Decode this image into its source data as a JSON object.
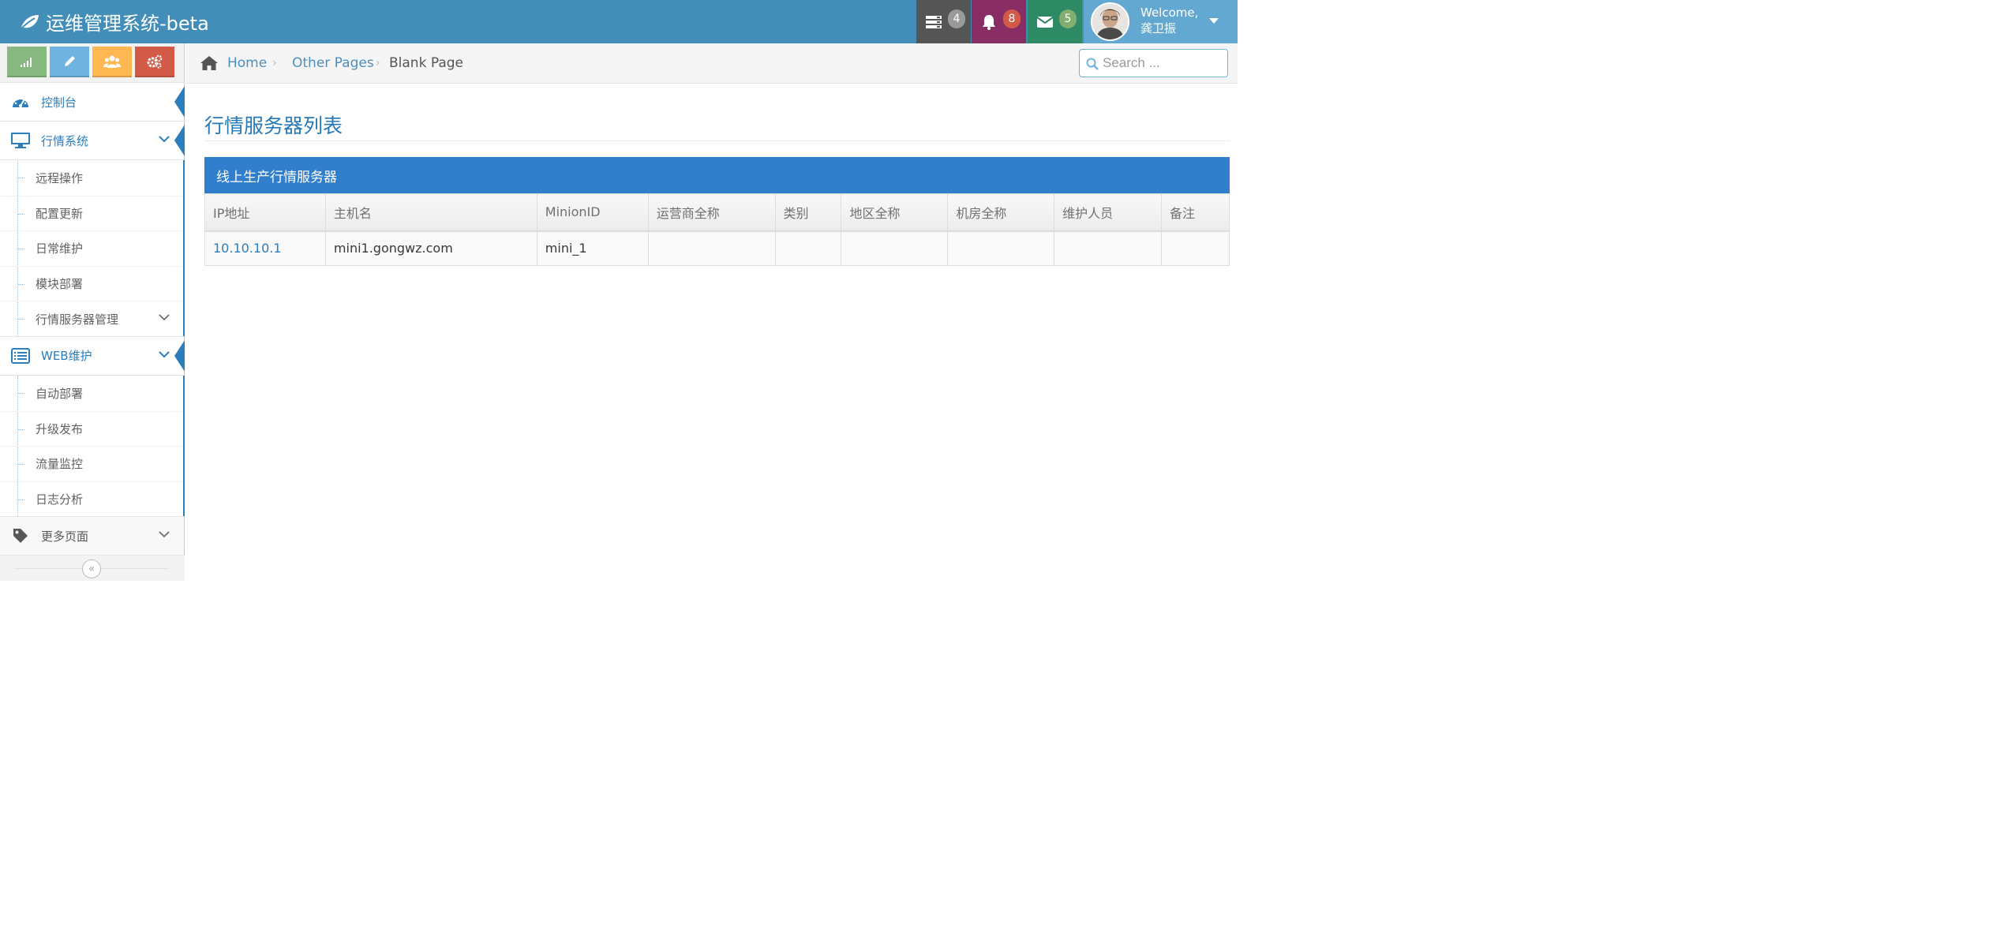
{
  "navbar": {
    "brand": "运维管理系统-beta",
    "tasks_count": "4",
    "notifications_count": "8",
    "messages_count": "5",
    "welcome": "Welcome,",
    "username": "龚卫振"
  },
  "sidebar": {
    "shortcuts": [
      "signal-icon",
      "pencil-icon",
      "group-icon",
      "cogs-icon"
    ],
    "dashboard": "控制台",
    "market_system": {
      "label": "行情系统",
      "items": [
        "远程操作",
        "配置更新",
        "日常维护",
        "模块部署",
        "行情服务器管理"
      ]
    },
    "web_maint": {
      "label": "WEB维护",
      "items": [
        "自动部署",
        "升级发布",
        "流量监控",
        "日志分析"
      ]
    },
    "more_pages": "更多页面"
  },
  "breadcrumbs": {
    "home": "Home",
    "other": "Other Pages",
    "current": "Blank Page"
  },
  "search": {
    "placeholder": "Search ..."
  },
  "page_title": "行情服务器列表",
  "panel_title": "线上生产行情服务器",
  "table": {
    "headers": [
      "IP地址",
      "主机名",
      "MinionID",
      "运营商全称",
      "类别",
      "地区全称",
      "机房全称",
      "维护人员",
      "备注"
    ],
    "rows": [
      [
        "10.10.10.1",
        "mini1.gongwz.com",
        "mini_1",
        "",
        "",
        "",
        "",
        "",
        ""
      ]
    ]
  },
  "colors": {
    "navbar": "#438eb9",
    "accent": "#2b7dbc",
    "panel_header": "#307ecc"
  }
}
